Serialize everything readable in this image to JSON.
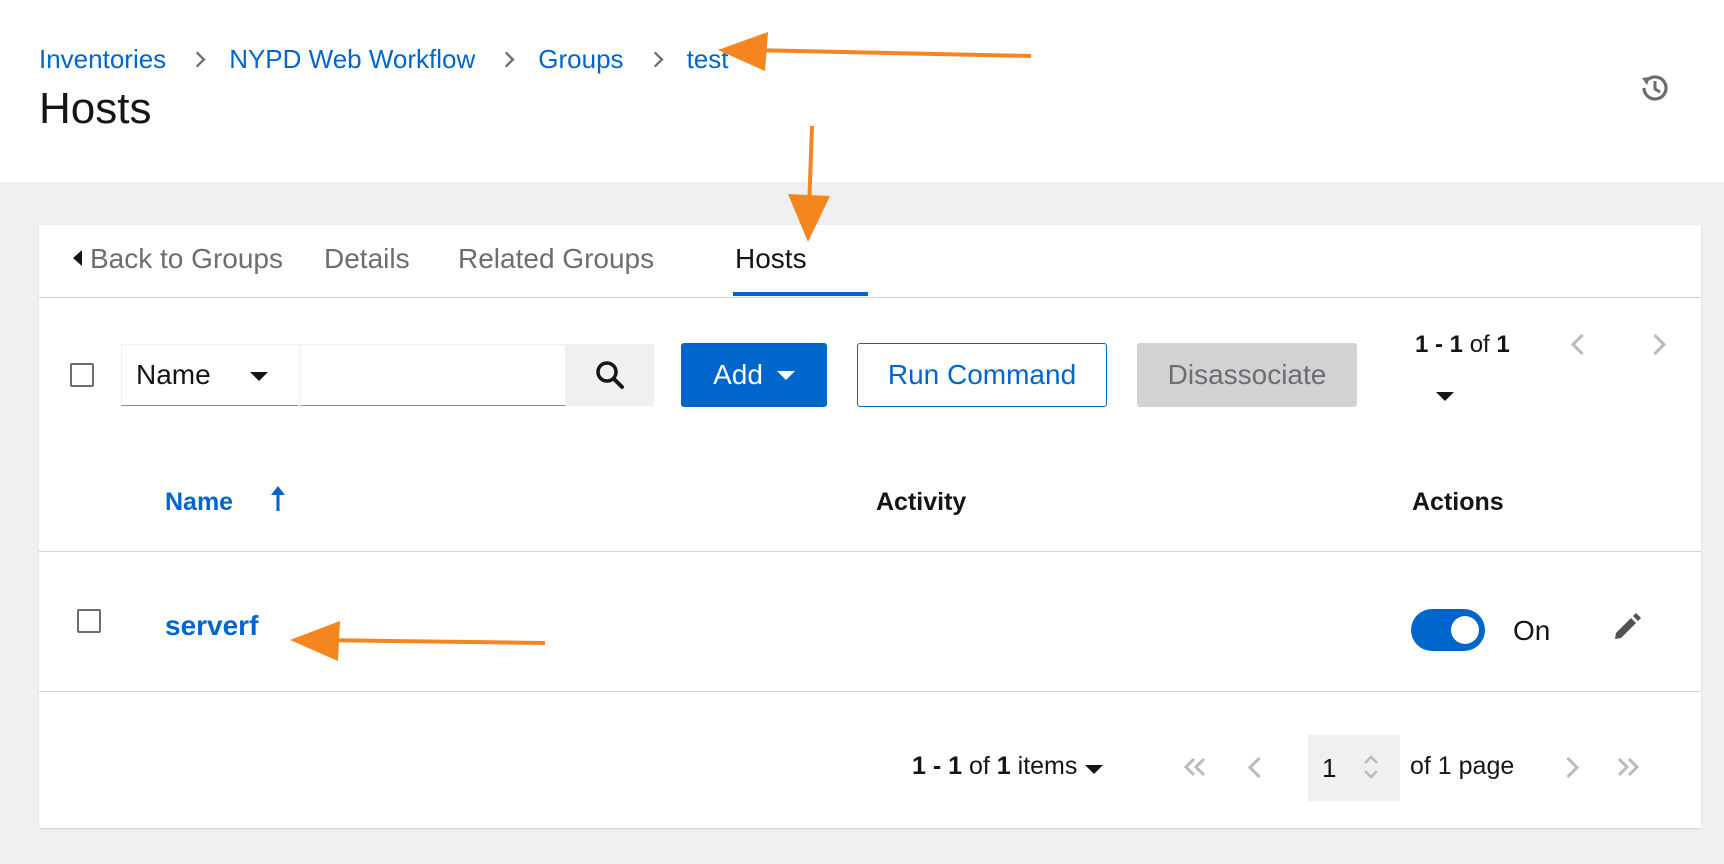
{
  "breadcrumb": [
    {
      "label": "Inventories"
    },
    {
      "label": "NYPD Web Workflow"
    },
    {
      "label": "Groups"
    },
    {
      "label": "test"
    }
  ],
  "page_title": "Hosts",
  "tabs": {
    "back": "Back to Groups",
    "details": "Details",
    "related_groups": "Related Groups",
    "hosts": "Hosts",
    "active": "Hosts"
  },
  "toolbar": {
    "filter_field": "Name",
    "search_value": "",
    "add_label": "Add",
    "run_command_label": "Run Command",
    "disassociate_label": "Disassociate"
  },
  "pagination_top": {
    "range": "1 - 1",
    "of_word": "of",
    "total": "1"
  },
  "table": {
    "columns": {
      "name": "Name",
      "activity": "Activity",
      "actions": "Actions"
    },
    "sort_icon": "sort-ascending-icon",
    "rows": [
      {
        "name": "serverf",
        "enabled_label": "On",
        "enabled": true
      }
    ]
  },
  "pagination_bottom": {
    "range": "1 - 1",
    "of_word": "of",
    "total": "1",
    "items_word": "items",
    "page": "1",
    "of_pages": "of 1 page"
  },
  "icons": {
    "history": "history-icon",
    "search": "search-icon",
    "edit": "pencil-icon"
  },
  "colors": {
    "accent": "#0066cc",
    "annotation_arrow": "#f5851f",
    "disabled_bg": "#d2d2d2"
  }
}
